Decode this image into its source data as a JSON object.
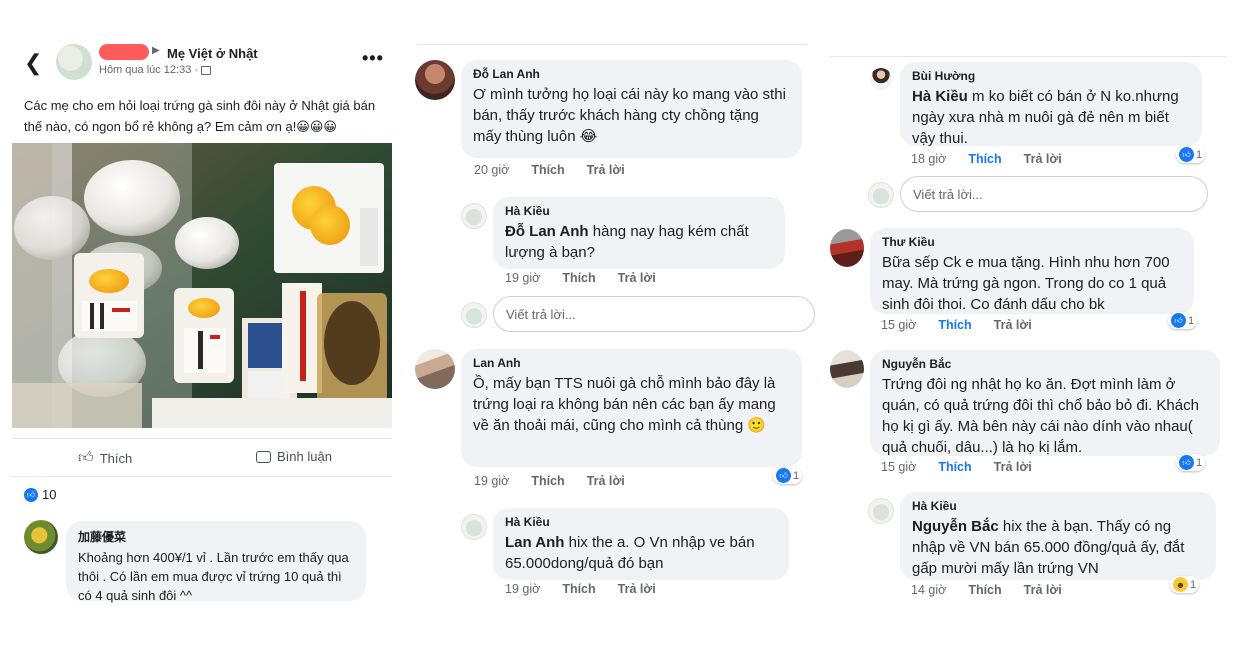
{
  "post": {
    "group_name": "Mẹ Việt ở Nhật",
    "timestamp": "Hôm qua lúc 12:33 · ",
    "text": "Các mẹ cho em hỏi loại trứng gà sinh đôi này ở Nhật giá bán thế nào, có ngon bổ rẻ không ạ? Em cảm ơn ạ!😀😀😀",
    "like_label": "Thích",
    "comment_label": "Bình luận",
    "reaction_count": "10",
    "photo_description": ""
  },
  "comments": [
    {
      "author": "加藤優菜",
      "text": "Khoảng hơn 400¥/1 vỉ . Lần trước em thấy qua thôi . Có lần em mua được vỉ trứng 10 quả thì có 4 quả sinh đôi ^^"
    },
    {
      "author": "Đỗ Lan Anh",
      "text": "Ơ mình tưởng họ loại cái này ko mang vào sthi bán, thấy trước khách hàng cty chồng tặng mấy thùng luôn 😂",
      "time": "20 giờ",
      "like": "Thích",
      "reply": "Trả lời"
    },
    {
      "author": "Hà Kiều",
      "mention": "Đỗ Lan Anh",
      "text": " hàng nay hag kém chất lượng à bạn?",
      "time": "19 giờ",
      "like": "Thích",
      "reply": "Trả lời"
    },
    {
      "placeholder": "Viết trả lời..."
    },
    {
      "author": "Lan Anh",
      "text": "Ồ, mấy bạn TTS nuôi gà chỗ mình bảo đây là trứng loại ra không bán nên các bạn ấy mang về ăn thoải mái, cũng cho mình cả thùng 🙂",
      "time": "19 giờ",
      "like": "Thích",
      "reply": "Trả lời",
      "reactions": "1"
    },
    {
      "author": "Hà Kiều",
      "mention": "Lan Anh",
      "text": " hix the a. O Vn nhập ve bán 65.000dong/quả đó bạn",
      "time": "19 giờ",
      "like": "Thích",
      "reply": "Trả lời"
    },
    {
      "author": "Bùi Hường",
      "mention": "Hà Kiều",
      "text": " m ko biết có bán ở N ko.nhưng ngày xưa nhà m nuôi gà đẻ nên m biết vậy thui.",
      "time": "18 giờ",
      "like": "Thích",
      "reply": "Trả lời",
      "reactions": "1"
    },
    {
      "placeholder": "Viết trả lời..."
    },
    {
      "author": "Thư Kiều",
      "text": "Bữa sếp Ck e mua tặng. Hình nhu hơn 700 may. Mà trứng gà ngon. Trong do co 1 quả sinh đôi thoi. Co đánh dấu cho bk",
      "time": "15 giờ",
      "like": "Thích",
      "reply": "Trả lời",
      "reactions": "1"
    },
    {
      "author": "Nguyễn Bắc",
      "text": "Trứng đôi ng nhật họ ko ăn. Đợt mình làm ở quán, có quả trứng đôi thì chổ bảo bỏ đi. Khách họ kị gì ấy. Mà bên này cái nào dính vào nhau( quả chuối, dâu...) là họ kị lắm.",
      "time": "15 giờ",
      "like": "Thích",
      "reply": "Trả lời",
      "reactions": "1"
    },
    {
      "author": "Hà Kiều",
      "mention": "Nguyễn Bắc",
      "text": " hix the à bạn. Thấy có ng nhập về VN bán 65.000 đồng/quả ấy, đắt gấp mười mấy lần trứng VN",
      "time": "14 giờ",
      "like": "Thích",
      "reply": "Trả lời",
      "reactions": "1"
    }
  ],
  "colors": {
    "accent": "#1877f2",
    "bubble": "#f0f2f5",
    "meta": "#65676b"
  }
}
